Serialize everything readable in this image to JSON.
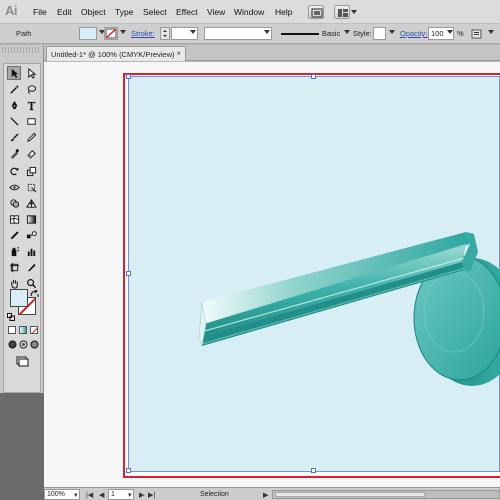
{
  "app": {
    "logo_text": "Ai"
  },
  "menubar": {
    "items": [
      "File",
      "Edit",
      "Object",
      "Type",
      "Select",
      "Effect",
      "View",
      "Window",
      "Help"
    ]
  },
  "controlbar": {
    "selection_type": "Path",
    "stroke_label": "Stroke:",
    "brush_label": "Basic",
    "style_label": "Style:",
    "opacity_label": "Opacity:",
    "opacity_value": "100",
    "opacity_unit": "%"
  },
  "document": {
    "tab_title": "Untitled-1* @ 100% (CMYK/Preview)",
    "close_glyph": "×"
  },
  "tools": {
    "fill_color": "#d7eef6",
    "stroke_color": "none"
  },
  "statusbar": {
    "zoom": "100%",
    "artboard_number": "1",
    "status_text": "Selection"
  },
  "colors": {
    "artboard_border": "#d6232f",
    "rect_fill": "#d8eef5",
    "selection_blue": "#5a70d6",
    "teal_dark": "#2aa39c",
    "teal_light": "#e8f6f5"
  }
}
